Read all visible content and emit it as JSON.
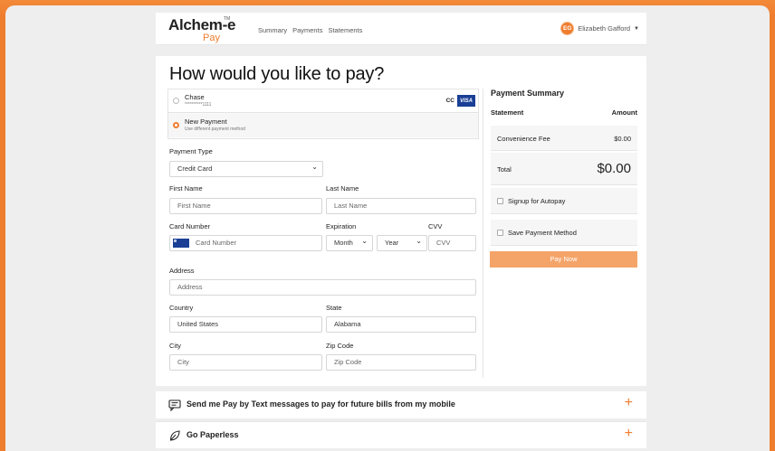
{
  "header": {
    "logo_main": "Alchem-e",
    "logo_tm": "TM",
    "logo_sub": "Pay",
    "nav": [
      "Summary",
      "Payments",
      "Statements"
    ],
    "user_initials": "EG",
    "user_name": "Elizabeth Gafford"
  },
  "main": {
    "title": "How would you like to pay?",
    "saved_method": {
      "name": "Chase",
      "masked": "**********1111",
      "type": "CC",
      "brand": "VISA"
    },
    "new_payment": {
      "name": "New Payment",
      "sub": "Use different payment method"
    },
    "payment_type": {
      "label": "Payment Type",
      "value": "Credit Card"
    },
    "first_name": {
      "label": "First Name",
      "placeholder": "First Name"
    },
    "last_name": {
      "label": "Last Name",
      "placeholder": "Last Name"
    },
    "card_number": {
      "label": "Card Number",
      "placeholder": "Card Number"
    },
    "expiration": {
      "label": "Expiration",
      "month": "Month",
      "year": "Year"
    },
    "cvv": {
      "label": "CVV",
      "placeholder": "CVV"
    },
    "address": {
      "label": "Address",
      "placeholder": "Address"
    },
    "country": {
      "label": "Country",
      "value": "United States"
    },
    "state": {
      "label": "State",
      "value": "Alabama"
    },
    "city": {
      "label": "City",
      "placeholder": "City"
    },
    "zip": {
      "label": "Zip Code",
      "placeholder": "Zip Code"
    }
  },
  "summary": {
    "title": "Payment Summary",
    "col_statement": "Statement",
    "col_amount": "Amount",
    "fee_label": "Convenience Fee",
    "fee_value": "$0.00",
    "total_label": "Total",
    "total_value": "$0.00",
    "autopay_label": "Signup for Autopay",
    "save_label": "Save Payment Method",
    "pay_button": "Pay Now"
  },
  "bottom": {
    "text_pay": "Send me Pay by Text messages to pay for future bills from my mobile",
    "paperless": "Go Paperless",
    "plus": "+"
  },
  "colors": {
    "accent": "#ef7d2e",
    "visa": "#1a3f95",
    "pay_button": "#f5a469"
  }
}
